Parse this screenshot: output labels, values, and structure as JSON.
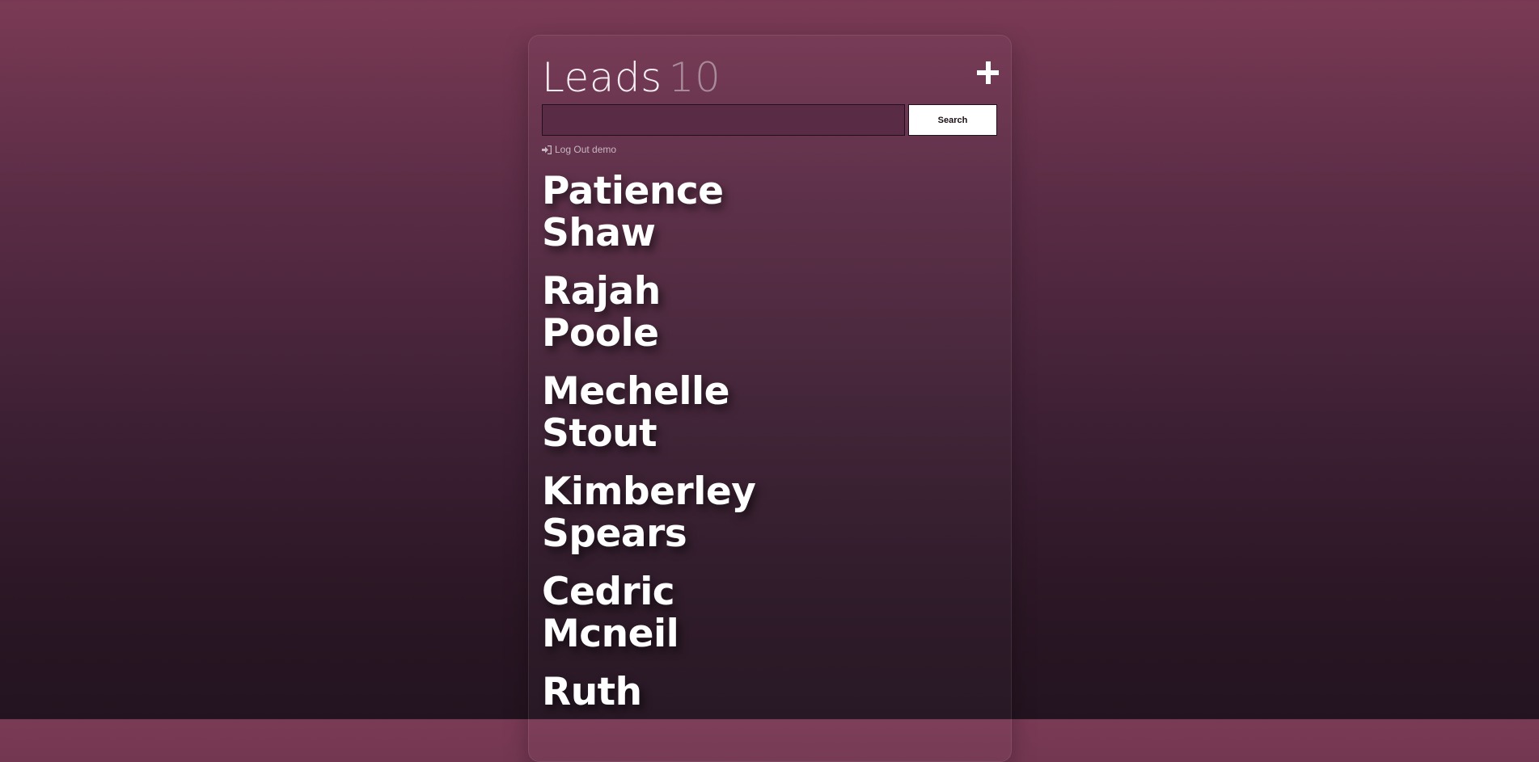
{
  "header": {
    "title": "Leads",
    "count": "10",
    "add_icon": "plus-icon"
  },
  "search": {
    "value": "",
    "placeholder": "",
    "button_label": "Search"
  },
  "logout": {
    "icon": "sign-out-icon",
    "label": "Log Out demo"
  },
  "leads": [
    {
      "first": "Patience",
      "last": "Shaw"
    },
    {
      "first": "Rajah",
      "last": "Poole"
    },
    {
      "first": "Mechelle",
      "last": "Stout"
    },
    {
      "first": "Kimberley",
      "last": "Spears"
    },
    {
      "first": "Cedric",
      "last": "Mcneil"
    },
    {
      "first": "Ruth",
      "last": ""
    }
  ]
}
